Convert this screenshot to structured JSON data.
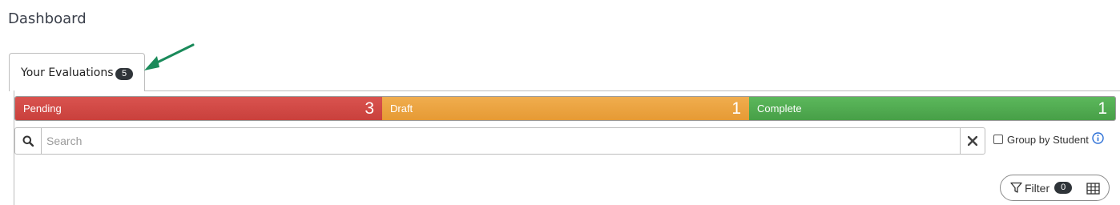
{
  "page": {
    "title": "Dashboard"
  },
  "tabs": [
    {
      "label": "Your Evaluations",
      "badge": "5"
    }
  ],
  "status_bar": {
    "segments": [
      {
        "label": "Pending",
        "count": "3",
        "color": "#d9534f"
      },
      {
        "label": "Draft",
        "count": "1",
        "color": "#f0ad4e"
      },
      {
        "label": "Complete",
        "count": "1",
        "color": "#5cb85c"
      }
    ]
  },
  "search": {
    "placeholder": "Search",
    "value": "",
    "icon": "search-icon",
    "clear_icon": "close-icon"
  },
  "group_by": {
    "label": "Group by Student",
    "checked": false,
    "info_icon": "info-icon"
  },
  "filter": {
    "label": "Filter",
    "badge": "0",
    "icon": "filter-icon",
    "view_icon": "table-icon"
  },
  "annotation": {
    "color": "#1a8a5a"
  }
}
